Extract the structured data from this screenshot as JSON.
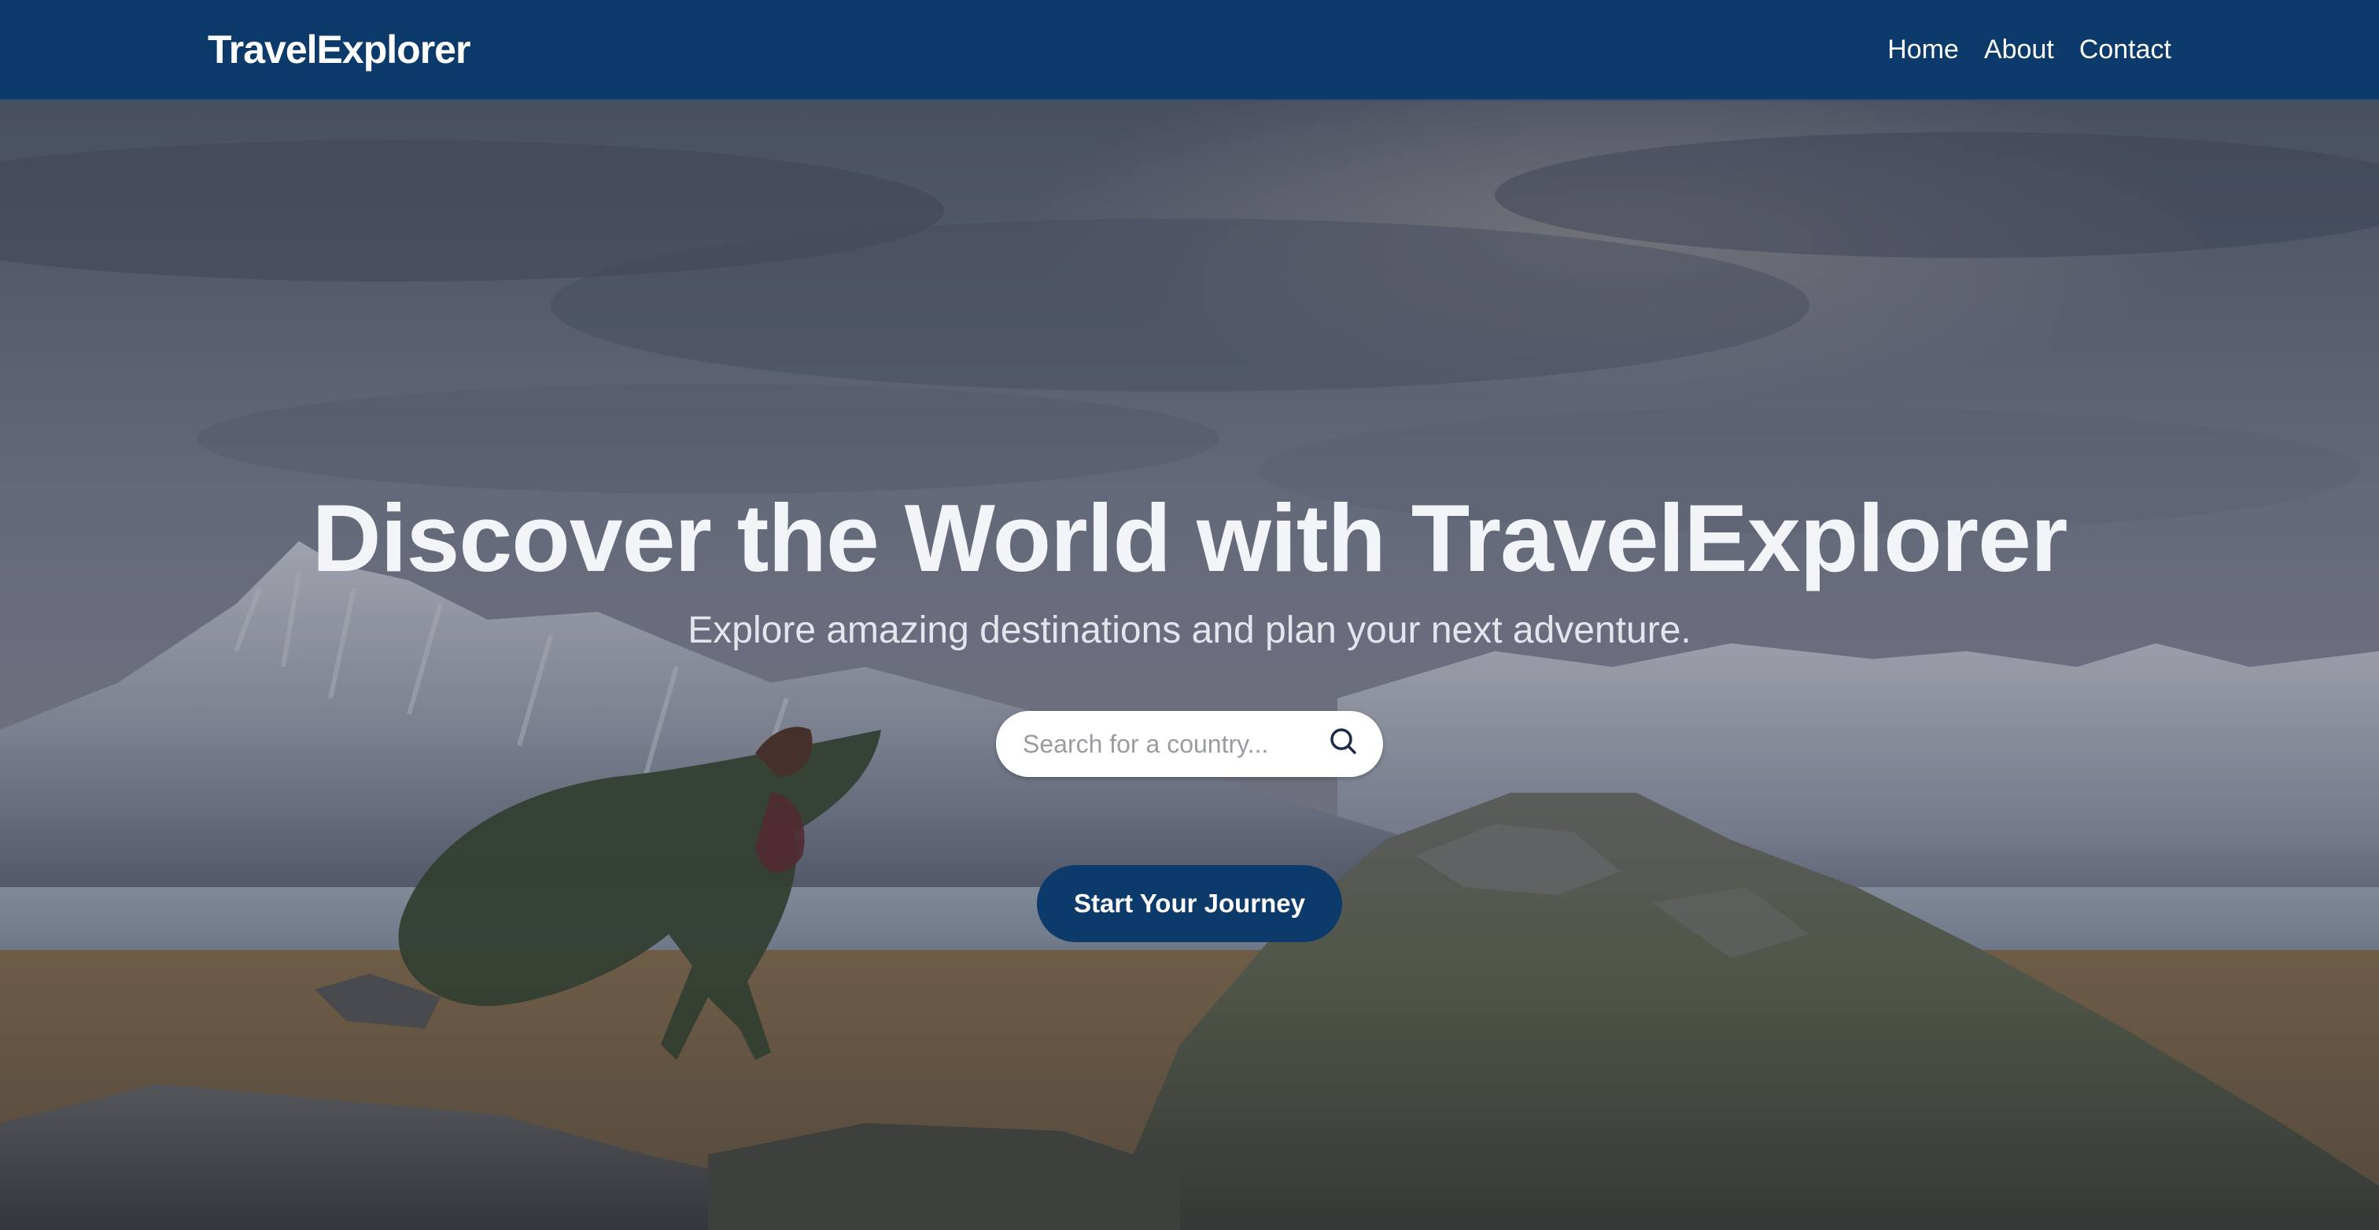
{
  "nav": {
    "brand": "TravelExplorer",
    "links": [
      {
        "label": "Home"
      },
      {
        "label": "About"
      },
      {
        "label": "Contact"
      }
    ]
  },
  "hero": {
    "title": "Discover the World with TravelExplorer",
    "subtitle": "Explore amazing destinations and plan your next adventure.",
    "background_scene": "snowy mountains, lake, mossy rocks, person in green cloak",
    "search": {
      "placeholder": "Search for a country...",
      "value": "",
      "icon": "search-icon"
    },
    "cta_label": "Start Your Journey"
  },
  "colors": {
    "primary": "#0c3b6b",
    "nav_text": "#ffffff",
    "hero_title": "#f3f4f8",
    "search_bg": "#ffffff",
    "placeholder": "#9a9ca3"
  }
}
